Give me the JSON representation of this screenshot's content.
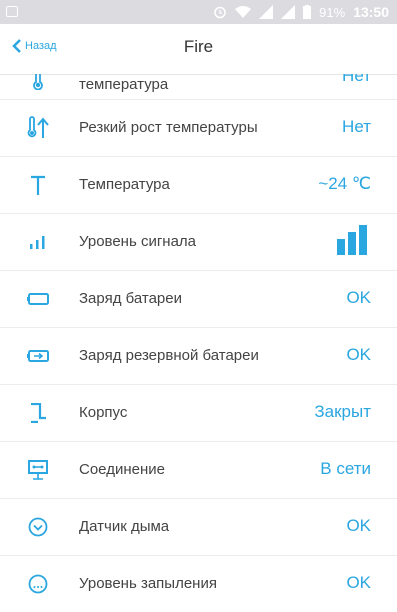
{
  "status_bar": {
    "battery": "91%",
    "time": "13:50"
  },
  "header": {
    "back_label": "Назад",
    "title": "Fire"
  },
  "rows": [
    {
      "label": "температура",
      "value": "Нет",
      "icon": "thermometer-icon"
    },
    {
      "label": "Резкий рост температуры",
      "value": "Нет",
      "icon": "temperature-rise-icon"
    },
    {
      "label": "Температура",
      "value": "~24 ℃",
      "icon": "temperature-T-icon"
    },
    {
      "label": "Уровень сигнала",
      "value": "",
      "icon": "signal-icon",
      "value_icon": "signal-bars-icon"
    },
    {
      "label": "Заряд батареи",
      "value": "OK",
      "icon": "battery-icon"
    },
    {
      "label": "Заряд резервной батареи",
      "value": "OK",
      "icon": "backup-battery-icon"
    },
    {
      "label": "Корпус",
      "value": "Закрыт",
      "icon": "case-icon"
    },
    {
      "label": "Соединение",
      "value": "В сети",
      "icon": "connection-icon"
    },
    {
      "label": "Датчик дыма",
      "value": "OK",
      "icon": "smoke-sensor-icon"
    },
    {
      "label": "Уровень запыления",
      "value": "OK",
      "icon": "dust-level-icon"
    }
  ],
  "colors": {
    "accent": "#2aa6e0",
    "status_bar": "#dcdce0",
    "text": "#444444"
  }
}
